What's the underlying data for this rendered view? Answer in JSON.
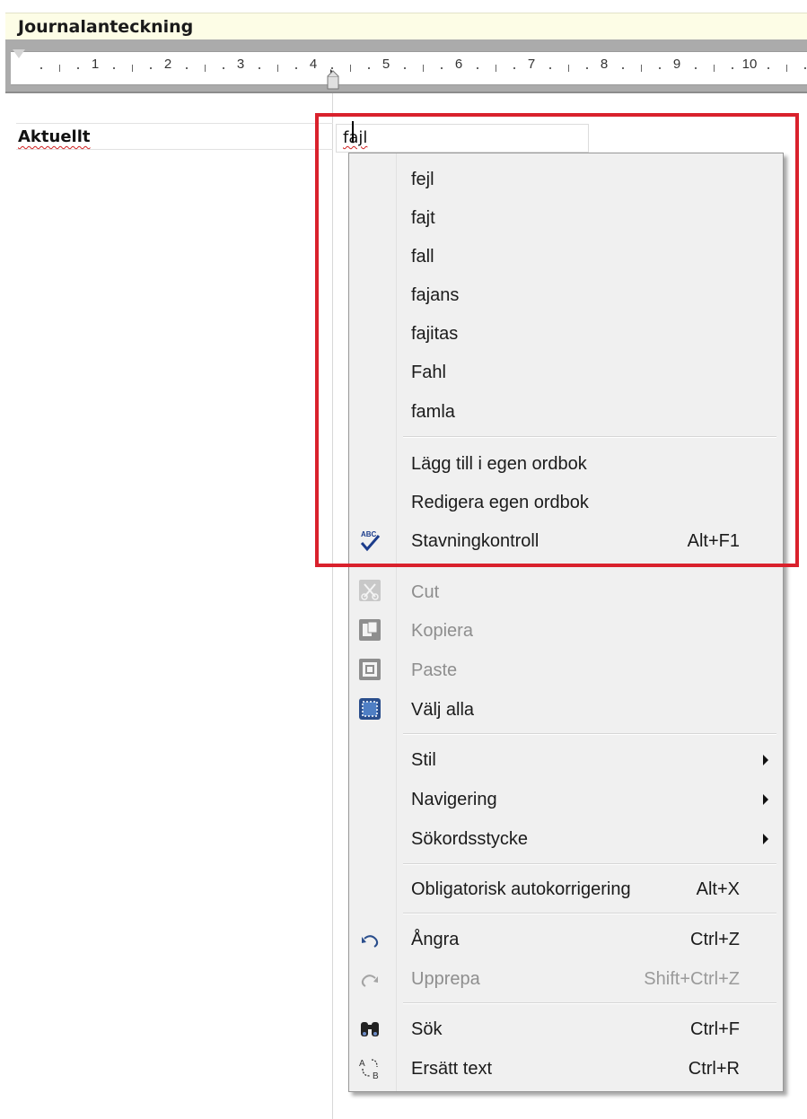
{
  "window": {
    "title": "Journalanteckning"
  },
  "ruler": {
    "numbers": [
      "1",
      "2",
      "3",
      "4",
      "5",
      "6",
      "7",
      "8",
      "9",
      "10"
    ]
  },
  "document": {
    "field_label": "Aktuellt",
    "field_value": "fajl"
  },
  "context_menu": {
    "suggestions": [
      "fejl",
      "fajt",
      "fall",
      "fajans",
      "fajitas",
      "Fahl",
      "famla"
    ],
    "add_to_dictionary": "Lägg till i egen ordbok",
    "edit_dictionary": "Redigera egen ordbok",
    "spellcheck": {
      "label": "Stavningkontroll",
      "shortcut": "Alt+F1",
      "icon": "abc-check-icon"
    },
    "cut": {
      "label": "Cut",
      "icon": "scissors-icon"
    },
    "copy": {
      "label": "Kopiera",
      "icon": "copy-icon"
    },
    "paste": {
      "label": "Paste",
      "icon": "paste-icon"
    },
    "select_all": {
      "label": "Välj alla",
      "icon": "select-all-icon"
    },
    "style": {
      "label": "Stil"
    },
    "navigation": {
      "label": "Navigering"
    },
    "keyword": {
      "label": "Sökordsstycke"
    },
    "autocorrect": {
      "label": "Obligatorisk autokorrigering",
      "shortcut": "Alt+X"
    },
    "undo": {
      "label": "Ångra",
      "shortcut": "Ctrl+Z",
      "icon": "undo-icon"
    },
    "redo": {
      "label": "Upprepa",
      "shortcut": "Shift+Ctrl+Z",
      "icon": "redo-icon"
    },
    "find": {
      "label": "Sök",
      "shortcut": "Ctrl+F",
      "icon": "binoculars-icon"
    },
    "replace": {
      "label": "Ersätt text",
      "shortcut": "Ctrl+R",
      "icon": "replace-icon"
    }
  },
  "colors": {
    "highlight_border": "#d9212c",
    "menu_bg": "#f0f0f0",
    "title_bg": "#fdfde6",
    "ruler_bg": "#ababab"
  }
}
